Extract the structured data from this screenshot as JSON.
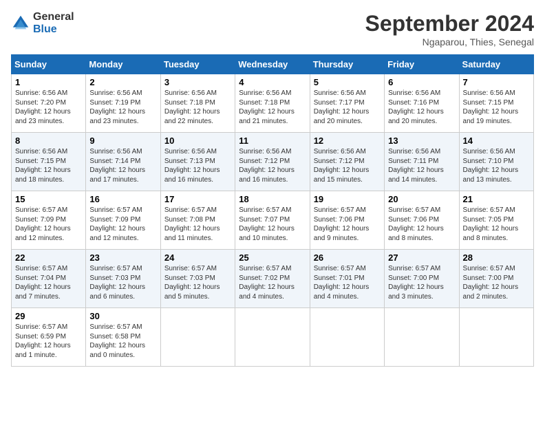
{
  "header": {
    "logo_line1": "General",
    "logo_line2": "Blue",
    "month_title": "September 2024",
    "location": "Ngaparou, Thies, Senegal"
  },
  "columns": [
    "Sunday",
    "Monday",
    "Tuesday",
    "Wednesday",
    "Thursday",
    "Friday",
    "Saturday"
  ],
  "weeks": [
    [
      {
        "day": "1",
        "sunrise": "6:56 AM",
        "sunset": "7:20 PM",
        "daylight": "12 hours and 23 minutes."
      },
      {
        "day": "2",
        "sunrise": "6:56 AM",
        "sunset": "7:19 PM",
        "daylight": "12 hours and 23 minutes."
      },
      {
        "day": "3",
        "sunrise": "6:56 AM",
        "sunset": "7:18 PM",
        "daylight": "12 hours and 22 minutes."
      },
      {
        "day": "4",
        "sunrise": "6:56 AM",
        "sunset": "7:18 PM",
        "daylight": "12 hours and 21 minutes."
      },
      {
        "day": "5",
        "sunrise": "6:56 AM",
        "sunset": "7:17 PM",
        "daylight": "12 hours and 20 minutes."
      },
      {
        "day": "6",
        "sunrise": "6:56 AM",
        "sunset": "7:16 PM",
        "daylight": "12 hours and 20 minutes."
      },
      {
        "day": "7",
        "sunrise": "6:56 AM",
        "sunset": "7:15 PM",
        "daylight": "12 hours and 19 minutes."
      }
    ],
    [
      {
        "day": "8",
        "sunrise": "6:56 AM",
        "sunset": "7:15 PM",
        "daylight": "12 hours and 18 minutes."
      },
      {
        "day": "9",
        "sunrise": "6:56 AM",
        "sunset": "7:14 PM",
        "daylight": "12 hours and 17 minutes."
      },
      {
        "day": "10",
        "sunrise": "6:56 AM",
        "sunset": "7:13 PM",
        "daylight": "12 hours and 16 minutes."
      },
      {
        "day": "11",
        "sunrise": "6:56 AM",
        "sunset": "7:12 PM",
        "daylight": "12 hours and 16 minutes."
      },
      {
        "day": "12",
        "sunrise": "6:56 AM",
        "sunset": "7:12 PM",
        "daylight": "12 hours and 15 minutes."
      },
      {
        "day": "13",
        "sunrise": "6:56 AM",
        "sunset": "7:11 PM",
        "daylight": "12 hours and 14 minutes."
      },
      {
        "day": "14",
        "sunrise": "6:56 AM",
        "sunset": "7:10 PM",
        "daylight": "12 hours and 13 minutes."
      }
    ],
    [
      {
        "day": "15",
        "sunrise": "6:57 AM",
        "sunset": "7:09 PM",
        "daylight": "12 hours and 12 minutes."
      },
      {
        "day": "16",
        "sunrise": "6:57 AM",
        "sunset": "7:09 PM",
        "daylight": "12 hours and 12 minutes."
      },
      {
        "day": "17",
        "sunrise": "6:57 AM",
        "sunset": "7:08 PM",
        "daylight": "12 hours and 11 minutes."
      },
      {
        "day": "18",
        "sunrise": "6:57 AM",
        "sunset": "7:07 PM",
        "daylight": "12 hours and 10 minutes."
      },
      {
        "day": "19",
        "sunrise": "6:57 AM",
        "sunset": "7:06 PM",
        "daylight": "12 hours and 9 minutes."
      },
      {
        "day": "20",
        "sunrise": "6:57 AM",
        "sunset": "7:06 PM",
        "daylight": "12 hours and 8 minutes."
      },
      {
        "day": "21",
        "sunrise": "6:57 AM",
        "sunset": "7:05 PM",
        "daylight": "12 hours and 8 minutes."
      }
    ],
    [
      {
        "day": "22",
        "sunrise": "6:57 AM",
        "sunset": "7:04 PM",
        "daylight": "12 hours and 7 minutes."
      },
      {
        "day": "23",
        "sunrise": "6:57 AM",
        "sunset": "7:03 PM",
        "daylight": "12 hours and 6 minutes."
      },
      {
        "day": "24",
        "sunrise": "6:57 AM",
        "sunset": "7:03 PM",
        "daylight": "12 hours and 5 minutes."
      },
      {
        "day": "25",
        "sunrise": "6:57 AM",
        "sunset": "7:02 PM",
        "daylight": "12 hours and 4 minutes."
      },
      {
        "day": "26",
        "sunrise": "6:57 AM",
        "sunset": "7:01 PM",
        "daylight": "12 hours and 4 minutes."
      },
      {
        "day": "27",
        "sunrise": "6:57 AM",
        "sunset": "7:00 PM",
        "daylight": "12 hours and 3 minutes."
      },
      {
        "day": "28",
        "sunrise": "6:57 AM",
        "sunset": "7:00 PM",
        "daylight": "12 hours and 2 minutes."
      }
    ],
    [
      {
        "day": "29",
        "sunrise": "6:57 AM",
        "sunset": "6:59 PM",
        "daylight": "12 hours and 1 minute."
      },
      {
        "day": "30",
        "sunrise": "6:57 AM",
        "sunset": "6:58 PM",
        "daylight": "12 hours and 0 minutes."
      },
      null,
      null,
      null,
      null,
      null
    ]
  ]
}
